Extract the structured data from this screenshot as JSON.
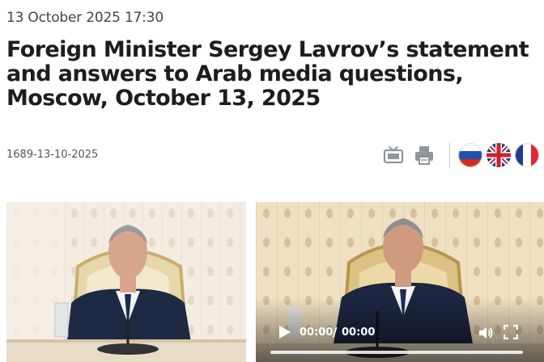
{
  "article": {
    "date": "13 October 2025 17:30",
    "title": "Foreign Minister Sergey Lavrov’s statement and answers to Arab media questions, Moscow, October 13, 2025",
    "document_number": "1689-13-10-2025"
  },
  "toolbar": {
    "icons": [
      "tv-icon",
      "print-icon"
    ],
    "languages": [
      "ru-flag-icon",
      "gb-flag-icon",
      "fr-flag-icon"
    ]
  },
  "video": {
    "current_time": "00:00",
    "separator": "/",
    "duration": "00:00",
    "progress": 0
  },
  "colors": {
    "icon_gray": "#8f969c",
    "divider": "#c8c8c8",
    "title_text": "#1d1d1d"
  }
}
